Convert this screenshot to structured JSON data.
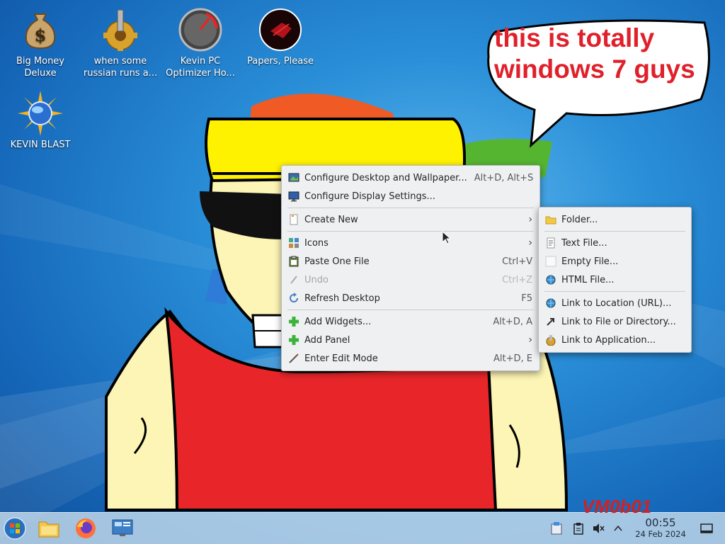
{
  "desktop_icons": [
    {
      "label": "Big Money Deluxe",
      "icon": "money-bag-icon"
    },
    {
      "label": "when some russian runs a...",
      "icon": "gear-icon"
    },
    {
      "label": "Kevin PC Optimizer Ho...",
      "icon": "gauge-icon"
    },
    {
      "label": "Papers, Please",
      "icon": "papers-please-icon"
    },
    {
      "label": "KEVIN BLAST",
      "icon": "sun-globe-icon"
    }
  ],
  "speech_bubble": {
    "text_line1": "this is totally",
    "text_line2": "windows 7 guys"
  },
  "watermark": "VM0b01",
  "context_menu": {
    "configure_desktop": {
      "label": "Configure Desktop and Wallpaper...",
      "shortcut": "Alt+D, Alt+S"
    },
    "configure_display": {
      "label": "Configure Display Settings..."
    },
    "create_new": {
      "label": "Create New"
    },
    "icons": {
      "label": "Icons"
    },
    "paste": {
      "label": "Paste One File",
      "shortcut": "Ctrl+V"
    },
    "undo": {
      "label": "Undo",
      "shortcut": "Ctrl+Z"
    },
    "refresh": {
      "label": "Refresh Desktop",
      "shortcut": "F5"
    },
    "add_widgets": {
      "label": "Add Widgets...",
      "shortcut": "Alt+D, A"
    },
    "add_panel": {
      "label": "Add Panel"
    },
    "edit_mode": {
      "label": "Enter Edit Mode",
      "shortcut": "Alt+D, E"
    }
  },
  "submenu": {
    "folder": "Folder...",
    "text_file": "Text File...",
    "empty_file": "Empty File...",
    "html_file": "HTML File...",
    "link_url": "Link to Location (URL)...",
    "link_file": "Link to File or Directory...",
    "link_app": "Link to Application..."
  },
  "taskbar": {
    "clock_time": "00:55",
    "clock_date": "24 Feb 2024"
  },
  "colors": {
    "accent": "#3daee9",
    "bubble_text": "#e0202a",
    "menu_bg": "#eff0f1"
  }
}
